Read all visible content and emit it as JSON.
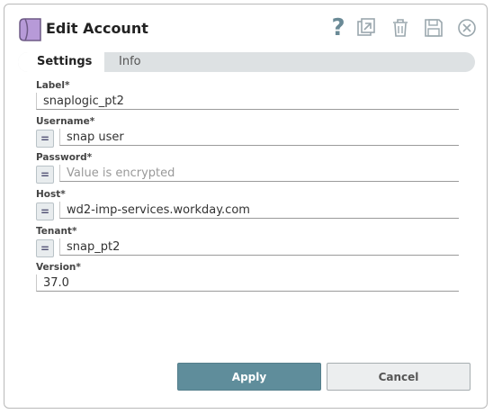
{
  "dialog": {
    "title": "Edit Account"
  },
  "toolbar": {
    "help": "?"
  },
  "tabs": [
    {
      "label": "Settings"
    },
    {
      "label": "Info"
    }
  ],
  "fields": {
    "label": {
      "label": "Label*",
      "value": "snaplogic_pt2"
    },
    "username": {
      "label": "Username*",
      "value": "snap user",
      "expr": "="
    },
    "password": {
      "label": "Password*",
      "placeholder": "Value is encrypted",
      "expr": "="
    },
    "host": {
      "label": "Host*",
      "value": "wd2-imp-services.workday.com",
      "expr": "="
    },
    "tenant": {
      "label": "Tenant*",
      "value": "snap_pt2",
      "expr": "="
    },
    "version": {
      "label": "Version*",
      "value": "37.0"
    }
  },
  "buttons": {
    "apply": "Apply",
    "cancel": "Cancel"
  },
  "colors": {
    "logo": "#b79ad8",
    "apply": "#5f8d9b",
    "icon": "#9aa7ad"
  }
}
